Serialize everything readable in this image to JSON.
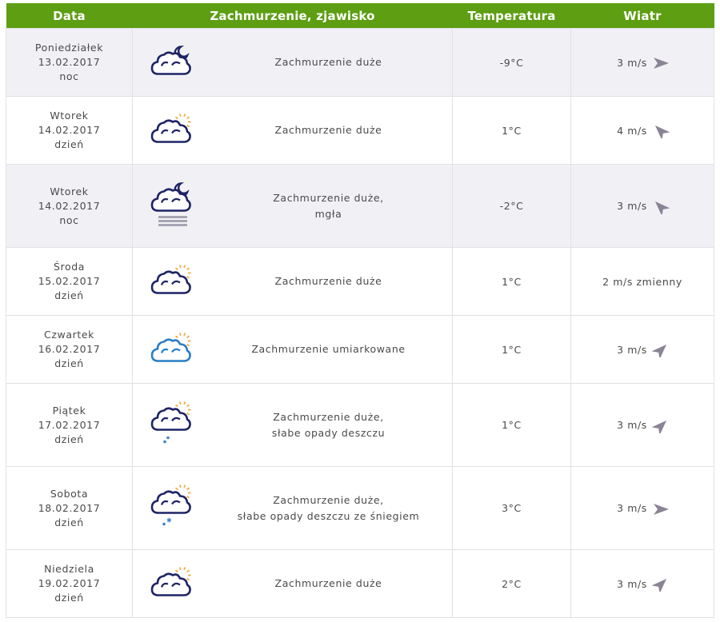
{
  "headers": {
    "date": "Data",
    "cond": "Zachmurzenie, zjawisko",
    "temp": "Temperatura",
    "wind": "Wiatr"
  },
  "rows": [
    {
      "day": "Poniedziałek",
      "date": "13.02.2017",
      "part": "noc",
      "cond1": "Zachmurzenie duże",
      "cond2": "",
      "temp": "-9°C",
      "wind": "3 m/s",
      "icon": "cloud-moon-icon",
      "arrow": "wind-arrow-east-icon"
    },
    {
      "day": "Wtorek",
      "date": "14.02.2017",
      "part": "dzień",
      "cond1": "Zachmurzenie duże",
      "cond2": "",
      "temp": "1°C",
      "wind": "4 m/s",
      "icon": "cloud-sun-icon",
      "arrow": "wind-arrow-northwest-icon"
    },
    {
      "day": "Wtorek",
      "date": "14.02.2017",
      "part": "noc",
      "cond1": "Zachmurzenie duże,",
      "cond2": "mgła",
      "temp": "-2°C",
      "wind": "3 m/s",
      "icon": "cloud-moon-fog-icon",
      "arrow": "wind-arrow-northwest-icon"
    },
    {
      "day": "Środa",
      "date": "15.02.2017",
      "part": "dzień",
      "cond1": "Zachmurzenie duże",
      "cond2": "",
      "temp": "1°C",
      "wind": "2 m/s zmienny",
      "icon": "cloud-sun-icon",
      "arrow": ""
    },
    {
      "day": "Czwartek",
      "date": "16.02.2017",
      "part": "dzień",
      "cond1": "Zachmurzenie umiarkowane",
      "cond2": "",
      "temp": "1°C",
      "wind": "3 m/s",
      "icon": "cloud-sun-blue-icon",
      "arrow": "wind-arrow-northeast-icon"
    },
    {
      "day": "Piątek",
      "date": "17.02.2017",
      "part": "dzień",
      "cond1": "Zachmurzenie duże,",
      "cond2": "słabe opady deszczu",
      "temp": "1°C",
      "wind": "3 m/s",
      "icon": "cloud-sun-rain-icon",
      "arrow": "wind-arrow-northeast-icon"
    },
    {
      "day": "Sobota",
      "date": "18.02.2017",
      "part": "dzień",
      "cond1": "Zachmurzenie duże,",
      "cond2": "słabe opady deszczu ze śniegiem",
      "temp": "3°C",
      "wind": "3 m/s",
      "icon": "cloud-sun-sleet-icon",
      "arrow": "wind-arrow-east-icon"
    },
    {
      "day": "Niedziela",
      "date": "19.02.2017",
      "part": "dzień",
      "cond1": "Zachmurzenie duże",
      "cond2": "",
      "temp": "2°C",
      "wind": "3 m/s",
      "icon": "cloud-sun-icon",
      "arrow": "wind-arrow-northeast-icon"
    }
  ],
  "colors": {
    "header": "#5d9e12",
    "cloud_dark": "#1f2466",
    "cloud_blue": "#2b7fc6",
    "sun": "#f2a32b",
    "fog": "#9c97a8",
    "rain": "#3d7fc6",
    "arrow": "#8a8496"
  }
}
